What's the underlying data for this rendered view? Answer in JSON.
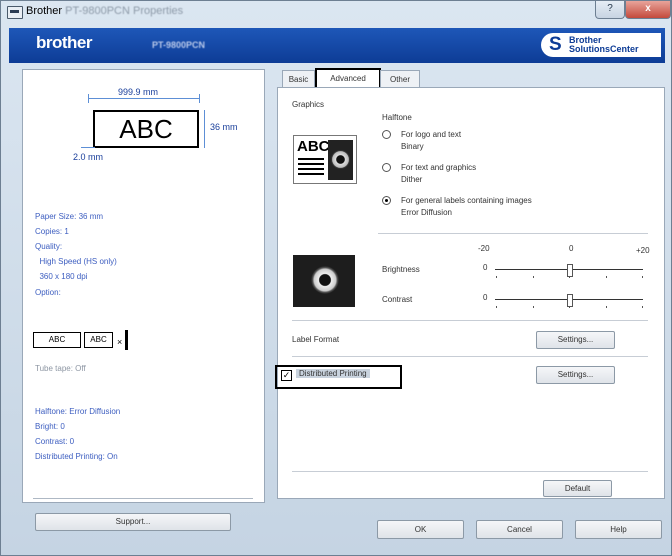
{
  "title": {
    "app": "Brother",
    "model": "PT-9800PCN",
    "suffix": "Properties"
  },
  "titlebar_buttons": {
    "help": "?",
    "close": "x"
  },
  "brand": {
    "logo": "brother",
    "model": "PT-9800PCN",
    "solutions_line1": "Brother",
    "solutions_line2": "SolutionsCenter",
    "solutions_icon": "S"
  },
  "preview": {
    "label_text": "ABC",
    "width_dim": "999.9 mm",
    "height_dim": "36 mm",
    "margin_dim": "2.0 mm",
    "info_lines": [
      "Paper Size: 36 mm",
      "Copies: 1",
      "Quality:",
      "  High Speed (HS only)",
      "  360 x 180 dpi",
      "Option:"
    ],
    "cut_boxes": [
      "ABC",
      "ABC"
    ],
    "tube_tape": "Tube tape: Off",
    "summary_lines": [
      "Halftone: Error Diffusion",
      "Bright: 0",
      "Contrast: 0",
      "Distributed Printing: On"
    ],
    "support_button": "Support..."
  },
  "tabs": [
    "Basic",
    "Advanced",
    "Other"
  ],
  "active_tab": "Advanced",
  "graphics": {
    "label": "Graphics",
    "sample_text": "ABC",
    "halftone_label": "Halftone",
    "options": [
      {
        "line1": "For logo and text",
        "line2": "Binary",
        "selected": false
      },
      {
        "line1": "For text and graphics",
        "line2": "Dither",
        "selected": false
      },
      {
        "line1": "For general labels containing images",
        "line2": "Error Diffusion",
        "selected": true
      }
    ]
  },
  "sliders": {
    "scale_min": "-20",
    "scale_mid": "0",
    "scale_max": "+20",
    "brightness": {
      "label": "Brightness",
      "value": "0",
      "level": 0.5
    },
    "contrast": {
      "label": "Contrast",
      "value": "0",
      "level": 0.5
    }
  },
  "label_format": {
    "label": "Label Format",
    "button": "Settings..."
  },
  "distributed": {
    "label": "Distributed Printing",
    "checked": true,
    "check_mark": "✓",
    "button": "Settings..."
  },
  "footer": {
    "default": "Default",
    "ok": "OK",
    "cancel": "Cancel",
    "help": "Help"
  },
  "colors": {
    "brand_blue": "#0d3c96",
    "info_blue": "#3d5ec0"
  }
}
